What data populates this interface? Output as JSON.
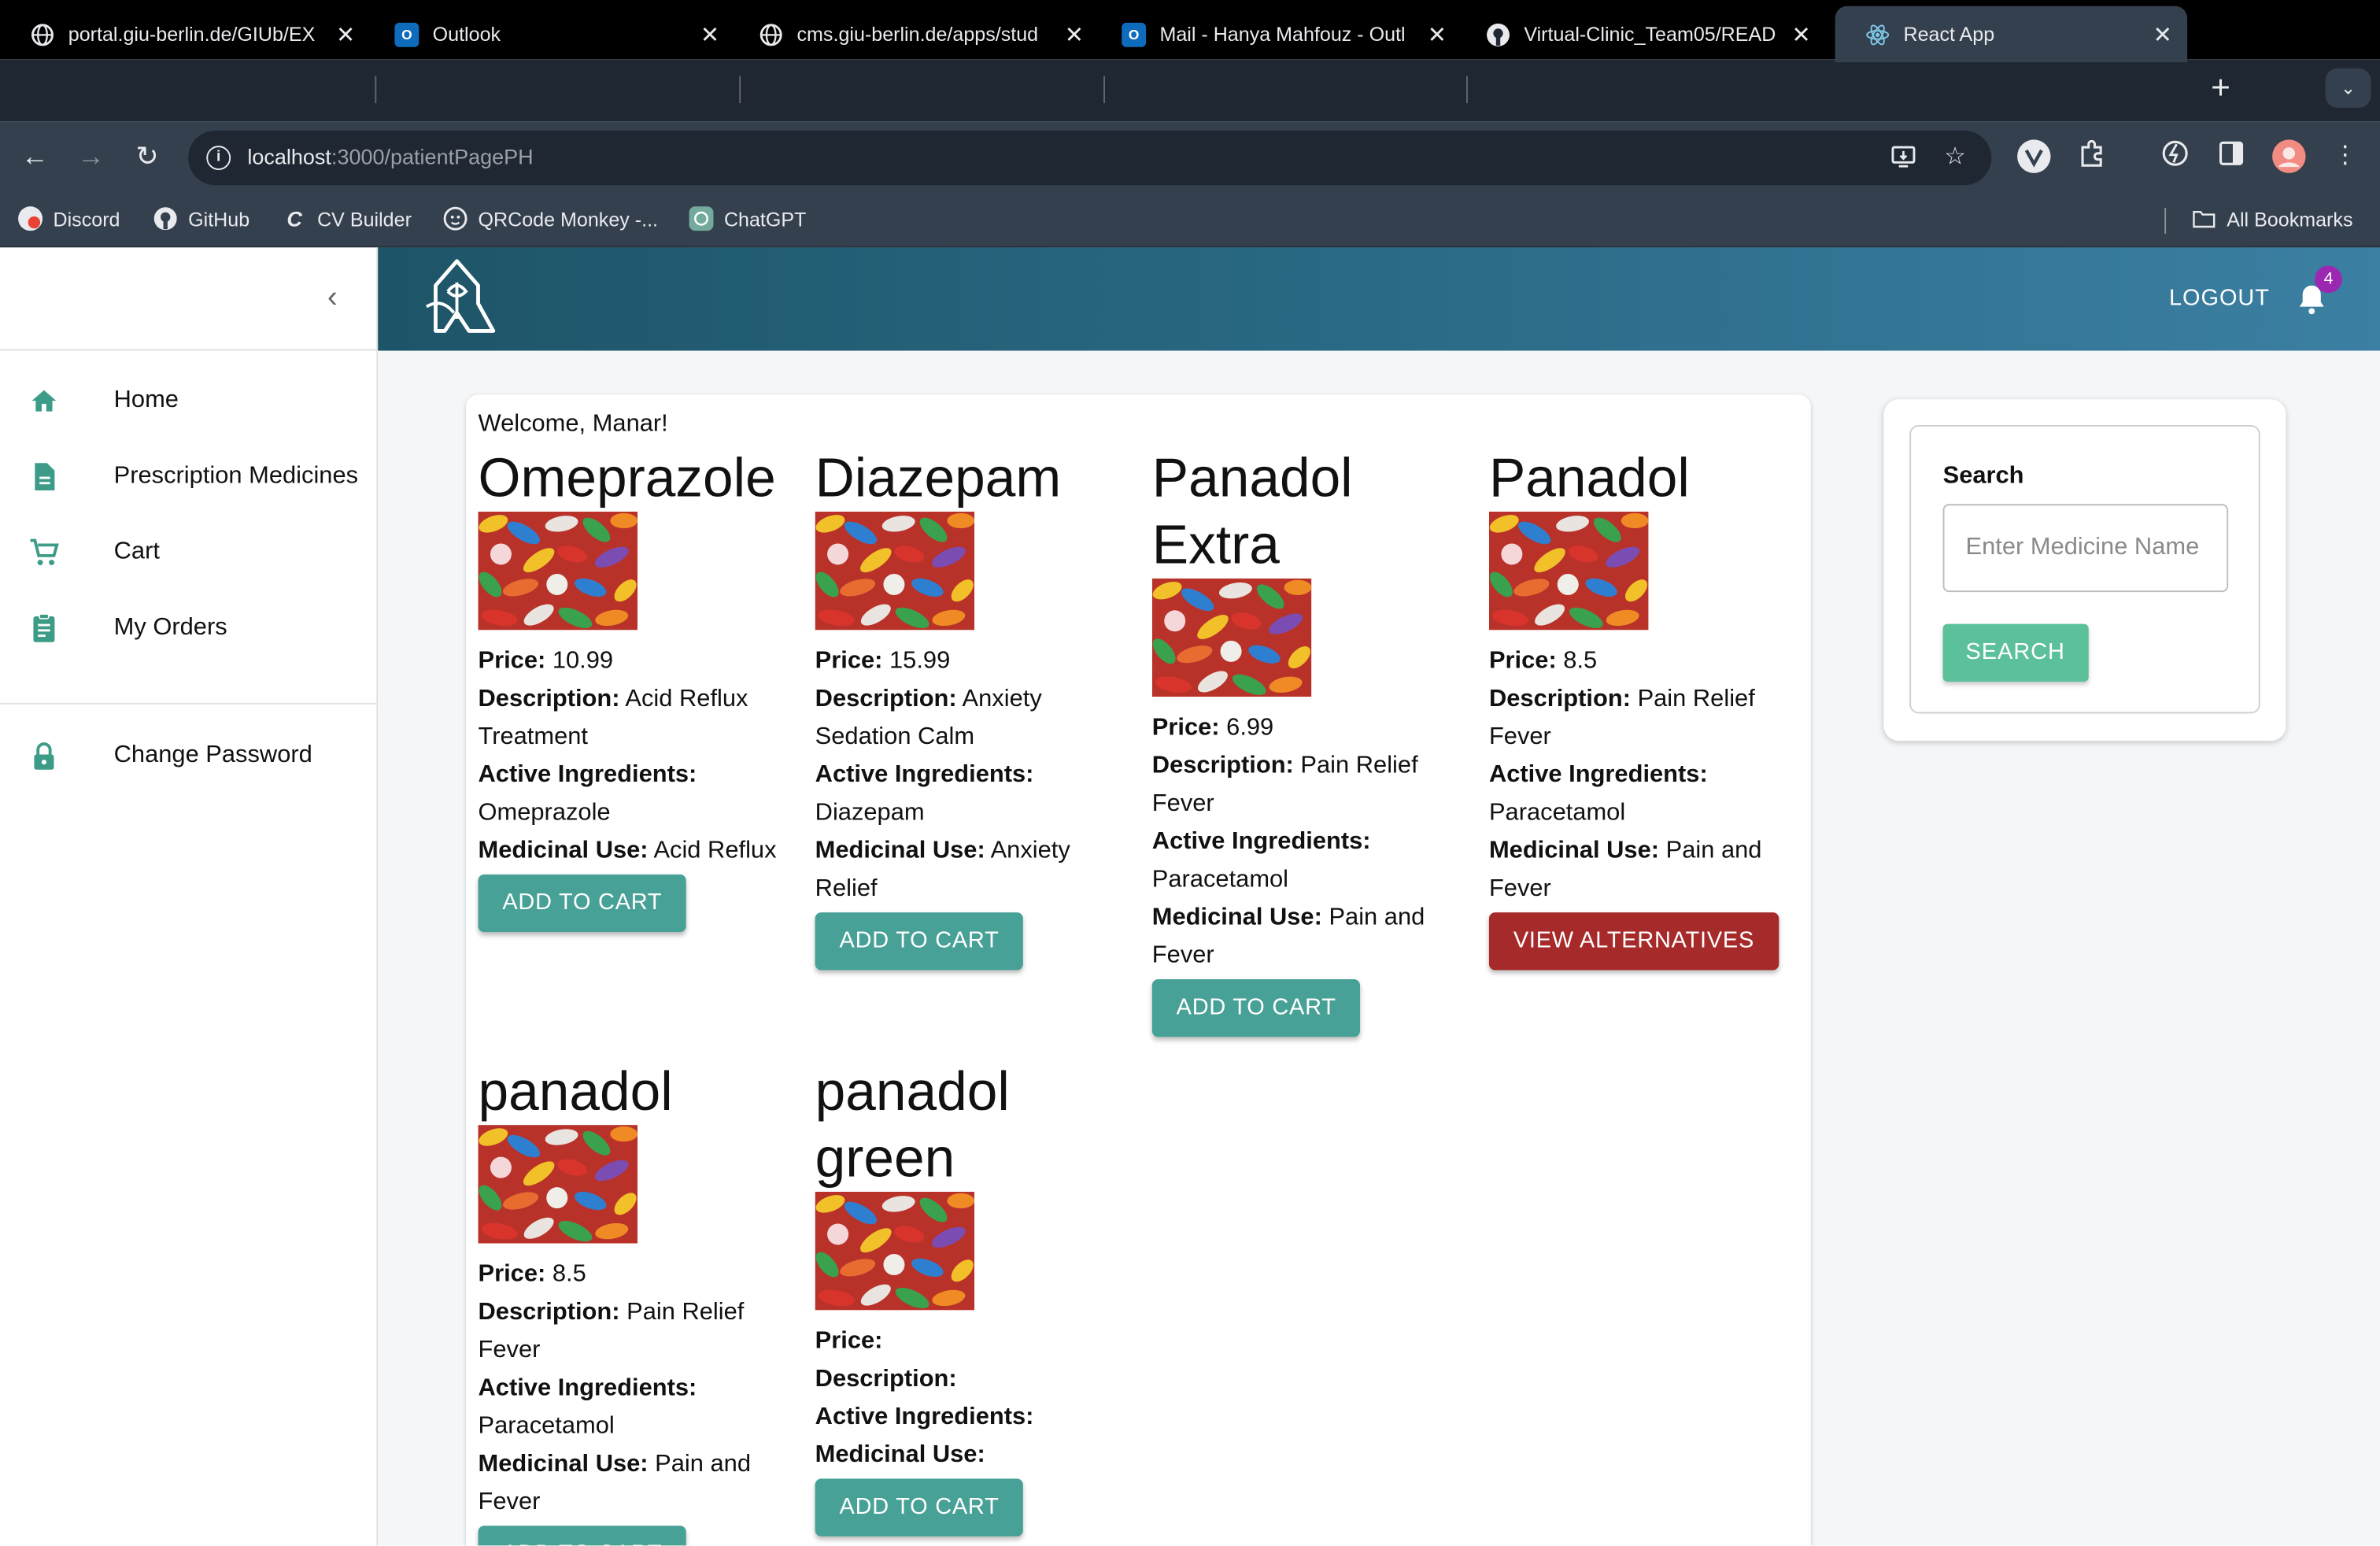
{
  "browser": {
    "tabs": [
      {
        "title": "portal.giu-berlin.de/GIUb/EX",
        "icon": "globe-icon"
      },
      {
        "title": "Outlook",
        "icon": "outlook-icon"
      },
      {
        "title": "cms.giu-berlin.de/apps/stud",
        "icon": "globe-icon"
      },
      {
        "title": "Mail - Hanya Mahfouz - Outl",
        "icon": "outlook-icon"
      },
      {
        "title": "Virtual-Clinic_Team05/READ",
        "icon": "github-icon"
      },
      {
        "title": "React App",
        "icon": "react-icon"
      }
    ],
    "new_tab": "+",
    "url_host": "localhost",
    "url_path": ":3000/patientPagePH",
    "bookmarks": [
      {
        "label": "Discord",
        "icon": "discord-icon"
      },
      {
        "label": "GitHub",
        "icon": "github-icon"
      },
      {
        "label": "CV Builder",
        "icon": "cv-builder-icon"
      },
      {
        "label": "QRCode Monkey -...",
        "icon": "monkey-icon"
      },
      {
        "label": "ChatGPT",
        "icon": "chatgpt-icon"
      }
    ],
    "all_bookmarks": "All Bookmarks"
  },
  "sidebar": {
    "items": [
      {
        "label": "Home",
        "icon": "home-icon"
      },
      {
        "label": "Prescription Medicines",
        "icon": "document-icon"
      },
      {
        "label": "Cart",
        "icon": "cart-icon"
      },
      {
        "label": "My Orders",
        "icon": "clipboard-icon"
      },
      {
        "label": "Change Password",
        "icon": "lock-icon"
      }
    ]
  },
  "header": {
    "logout": "LOGOUT",
    "notification_count": "4"
  },
  "main": {
    "welcome": "Welcome, Manar!",
    "labels": {
      "price": "Price:",
      "description": "Description:",
      "active": "Active Ingredients:",
      "use": "Medicinal Use:"
    },
    "medicines": [
      {
        "name": "Omeprazole",
        "price": "10.99",
        "description": "Acid Reflux Treatment",
        "active": "Omeprazole",
        "use": "Acid Reflux",
        "action": "ADD TO CART"
      },
      {
        "name": "Diazepam",
        "price": "15.99",
        "description": "Anxiety Sedation Calm",
        "active": "Diazepam",
        "use": "Anxiety Relief",
        "action": "ADD TO CART"
      },
      {
        "name": "Panadol Extra",
        "price": "6.99",
        "description": "Pain Relief Fever",
        "active": "Paracetamol",
        "use": "Pain and Fever",
        "action": "ADD TO CART"
      },
      {
        "name": "Panadol",
        "price": "8.5",
        "description": "Pain Relief Fever",
        "active": "Paracetamol",
        "use": "Pain and Fever",
        "action": "VIEW ALTERNATIVES"
      },
      {
        "name": "panadol",
        "price": "8.5",
        "description": "Pain Relief Fever",
        "active": "Paracetamol",
        "use": "Pain and Fever",
        "action": "ADD TO CART"
      },
      {
        "name": "panadol green",
        "price": "",
        "description": "",
        "active": "",
        "use": "",
        "action": "ADD TO CART"
      }
    ]
  },
  "search": {
    "label": "Search",
    "placeholder": "Enter Medicine Name",
    "button": "SEARCH"
  },
  "colors": {
    "teal": "#48a196",
    "red": "#a72a2a",
    "search_green": "#5cc19a",
    "header_start": "#1e5467",
    "header_end": "#3b7fa2",
    "sidebar_icon": "#3d9c87"
  }
}
